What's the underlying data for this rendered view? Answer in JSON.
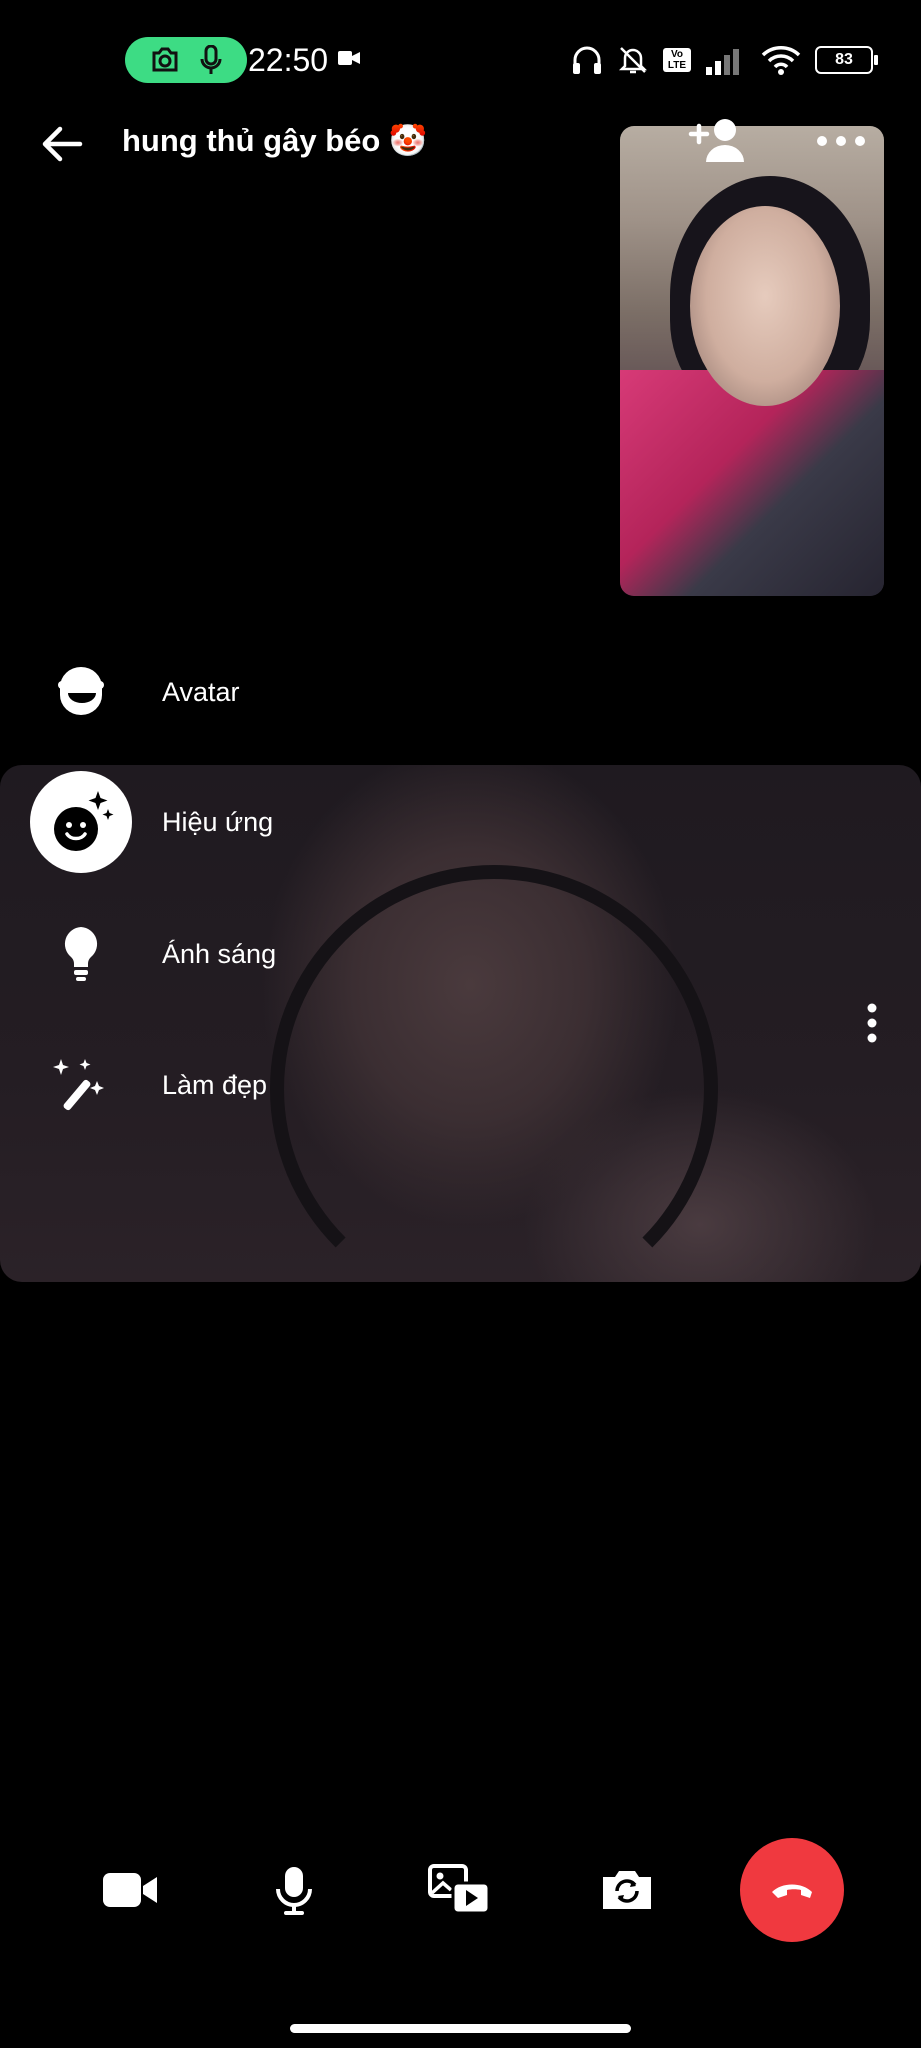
{
  "status_bar": {
    "time": "22:50",
    "battery": "83",
    "volte_top": "Vo",
    "volte_bottom": "LTE"
  },
  "header": {
    "contact_name": "hung thủ gây béo 🤡"
  },
  "effects_menu": {
    "items": [
      {
        "label": "Avatar",
        "icon": "avatar-icon"
      },
      {
        "label": "Hiệu ứng",
        "icon": "effects-icon",
        "selected": true
      },
      {
        "label": "Ánh sáng",
        "icon": "lightbulb-icon"
      },
      {
        "label": "Làm đẹp",
        "icon": "magic-wand-icon"
      }
    ]
  },
  "controls": {
    "icons": [
      "video-camera-icon",
      "microphone-icon",
      "media-share-icon",
      "flip-camera-icon",
      "end-call-icon"
    ],
    "end_call_color": "#f0393f"
  },
  "colors": {
    "recording_pill": "#3ddc84",
    "background": "#000000"
  }
}
